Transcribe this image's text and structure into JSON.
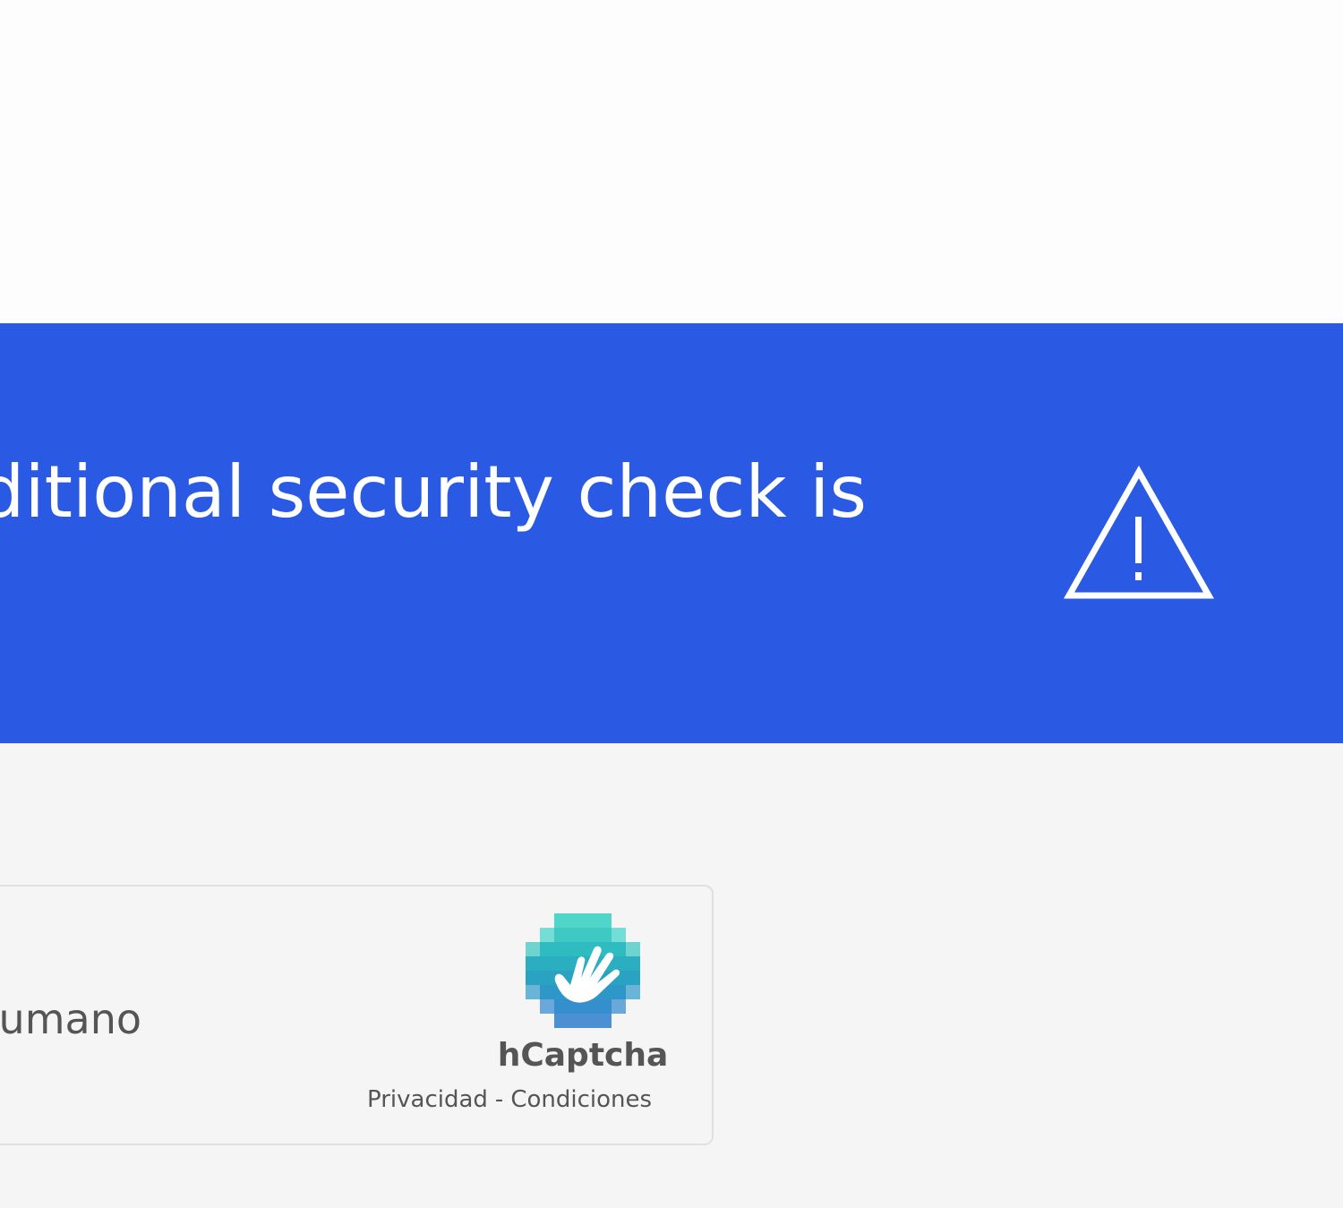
{
  "banner": {
    "message": "Additional security check is",
    "background_color": "#2a5ae3",
    "icon": "warning-triangle-icon"
  },
  "captcha": {
    "checkbox_label": "umano",
    "brand_name": "hCaptcha",
    "brand_icon": "hcaptcha-hand-icon",
    "privacy_link": "Privacidad",
    "separator": "-",
    "terms_link": "Condiciones"
  }
}
